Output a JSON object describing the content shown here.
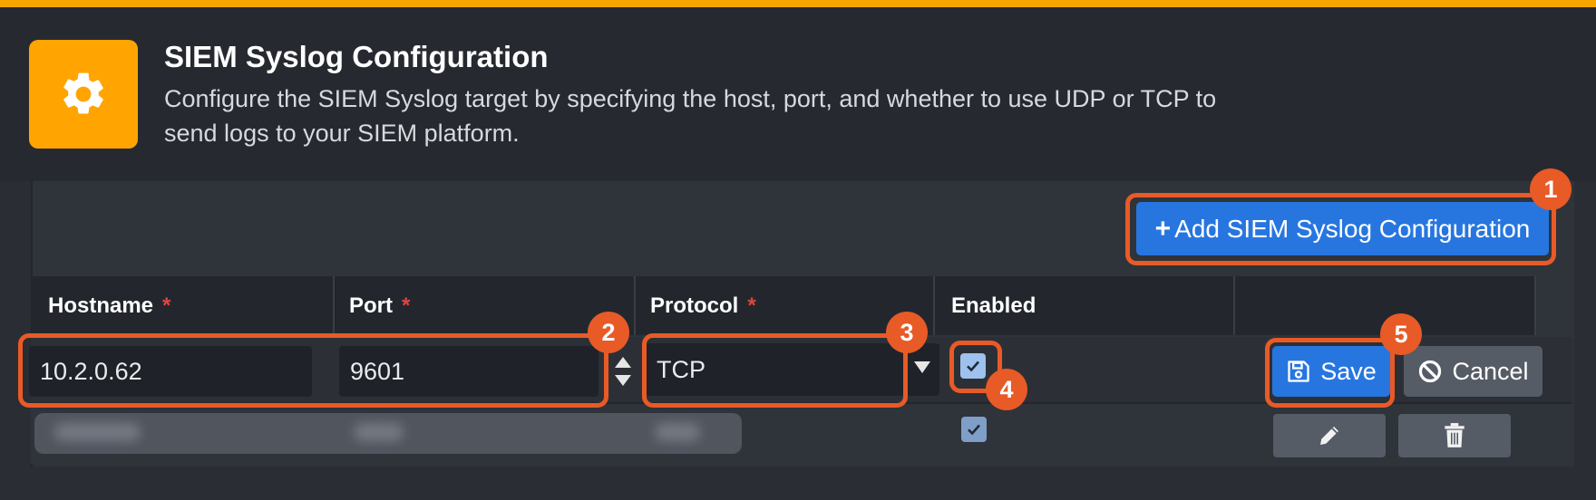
{
  "header": {
    "title": "SIEM Syslog Configuration",
    "description": "Configure the SIEM Syslog target by specifying the host, port, and whether to use UDP or TCP to send logs to your SIEM platform.",
    "icon": "gear-icon"
  },
  "toolbar": {
    "add_label": "Add SIEM Syslog Configuration",
    "add_icon": "plus-icon"
  },
  "table": {
    "columns": [
      {
        "label": "Hostname",
        "required": "*"
      },
      {
        "label": "Port",
        "required": "*"
      },
      {
        "label": "Protocol",
        "required": "*"
      },
      {
        "label": "Enabled",
        "required": ""
      }
    ],
    "edit_row": {
      "hostname": "10.2.0.62",
      "port": "9601",
      "protocol": "TCP",
      "enabled": true,
      "save_label": "Save",
      "cancel_label": "Cancel"
    },
    "existing_row": {
      "enabled": true
    }
  },
  "callouts": [
    "1",
    "2",
    "3",
    "4",
    "5"
  ],
  "colors": {
    "accent": "#f5a400",
    "primary": "#2776e0",
    "callout": "#e85a26"
  }
}
